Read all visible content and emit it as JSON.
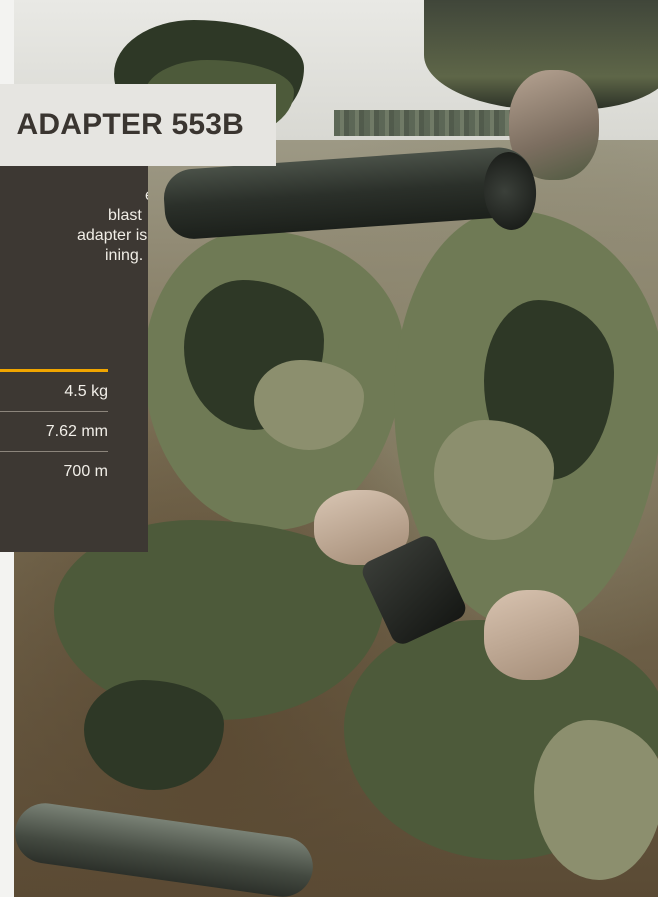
{
  "product": {
    "title": "ADAPTER 553B",
    "description_lines": [
      "eer",
      "blast",
      "adapter is",
      "ining."
    ]
  },
  "specs": [
    {
      "value": "4.5 kg"
    },
    {
      "value": "7.62 mm"
    },
    {
      "value": "700 m"
    }
  ],
  "colors": {
    "accent": "#f0a500",
    "panel": "#3d3833",
    "title_bg": "#e6e5e1"
  }
}
